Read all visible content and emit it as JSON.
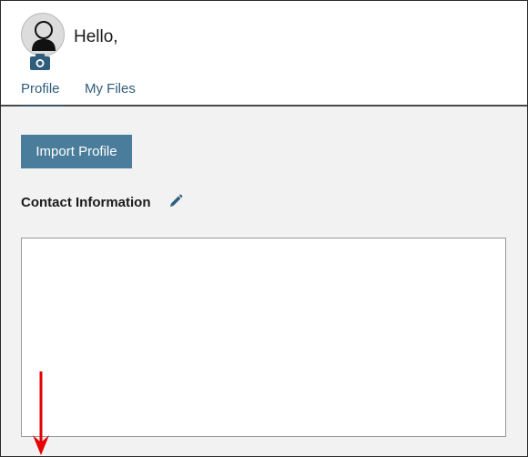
{
  "header": {
    "greeting": "Hello,",
    "avatar_icon": "user-avatar-icon",
    "camera_icon": "camera-icon"
  },
  "tabs": [
    {
      "label": "Profile",
      "active": true
    },
    {
      "label": "My Files",
      "active": false
    }
  ],
  "main": {
    "import_button_label": "Import Profile",
    "contact_section_title": "Contact Information",
    "edit_icon": "pencil-icon",
    "contact_box_content": ""
  },
  "annotation": {
    "arrow_icon": "down-arrow-icon"
  },
  "colors": {
    "accent": "#2f5d7c",
    "button": "#4a7d9b",
    "main_background": "#f2f2f2",
    "arrow": "#e60000"
  }
}
